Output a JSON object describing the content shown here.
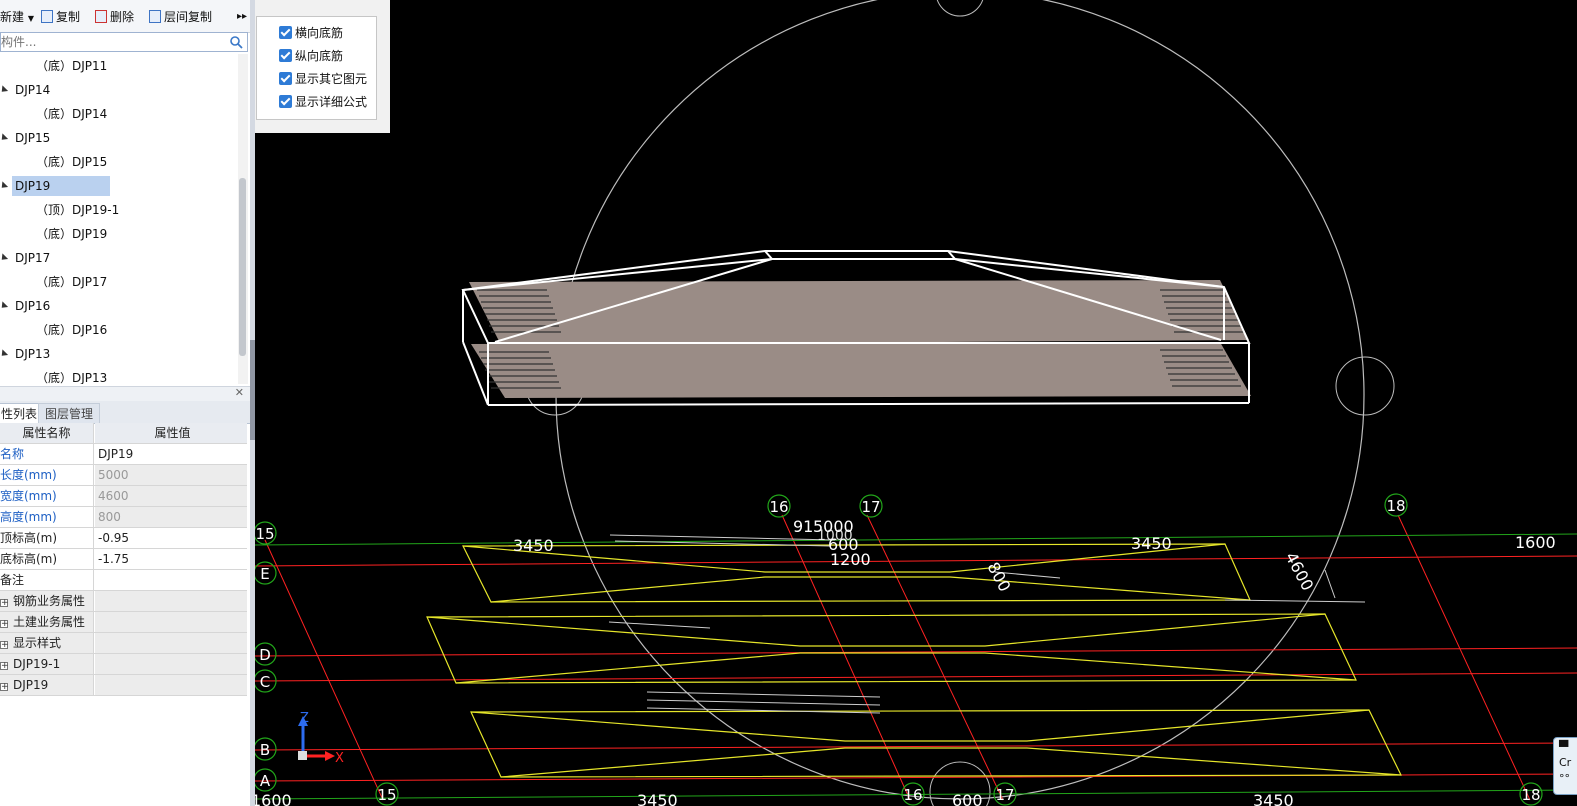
{
  "toolbar": {
    "new_label": "新建",
    "copy_label": "复制",
    "delete_label": "删除",
    "floor_copy_label": "层间复制",
    "more_icon": "double-chevron-right-icon"
  },
  "search": {
    "placeholder": "构件..."
  },
  "tree": {
    "items": [
      {
        "label": "（底）DJP11",
        "level": 1
      },
      {
        "label": "DJP14",
        "level": 0
      },
      {
        "label": "（底）DJP14",
        "level": 1
      },
      {
        "label": "DJP15",
        "level": 0
      },
      {
        "label": "（底）DJP15",
        "level": 1
      },
      {
        "label": "DJP19",
        "level": 0,
        "selected": true
      },
      {
        "label": "（顶）DJP19-1",
        "level": 1
      },
      {
        "label": "（底）DJP19",
        "level": 1
      },
      {
        "label": "DJP17",
        "level": 0
      },
      {
        "label": "（底）DJP17",
        "level": 1
      },
      {
        "label": "DJP16",
        "level": 0
      },
      {
        "label": "（底）DJP16",
        "level": 1
      },
      {
        "label": "DJP13",
        "level": 0
      },
      {
        "label": "（底）DJP13",
        "level": 1
      }
    ]
  },
  "panel_tabs": {
    "attr_list": "性列表",
    "layer_mgmt": "图层管理"
  },
  "prop_table": {
    "header_name": "属性名称",
    "header_value": "属性值",
    "rows": [
      {
        "name": "名称",
        "value": "DJP19"
      },
      {
        "name": "长度(mm)",
        "value": "5000"
      },
      {
        "name": "宽度(mm)",
        "value": "4600"
      },
      {
        "name": "高度(mm)",
        "value": "800"
      },
      {
        "name": "顶标高(m)",
        "value": "-0.95"
      },
      {
        "name": "底标高(m)",
        "value": "-1.75"
      },
      {
        "name": "备注",
        "value": ""
      },
      {
        "name": "钢筋业务属性",
        "value": ""
      },
      {
        "name": "土建业务属性",
        "value": ""
      },
      {
        "name": "显示样式",
        "value": ""
      },
      {
        "name": "DJP19-1",
        "value": ""
      },
      {
        "name": "DJP19",
        "value": ""
      }
    ]
  },
  "options": {
    "horizontal_bottom_rebar": "横向底筋",
    "vertical_bottom_rebar": "纵向底筋",
    "show_other_elements": "显示其它图元",
    "show_detail_formula": "显示详细公式"
  },
  "canvas": {
    "axis_numbers": {
      "a16": "16",
      "a17": "17",
      "a18": "18",
      "a15": "15",
      "b15": "15",
      "b16": "16",
      "b17": "17",
      "b18": "18"
    },
    "axis_letters": {
      "E": "E",
      "D": "D",
      "C": "C",
      "B": "B",
      "A": "A"
    },
    "dims": {
      "d3450_left": "3450",
      "d3450_right": "3450",
      "d1600": "1600",
      "d600": "600",
      "d1200": "1200",
      "d800": "800",
      "d4600": "4600",
      "d_overlap": "91",
      "d5000": "5000",
      "d1000": "1000",
      "b3450_left": "3450",
      "b600": "600",
      "b3450_right": "3450",
      "b1600": "1600"
    },
    "axes": {
      "z": "Z",
      "x": "X"
    },
    "colors": {
      "slab": "#9a8c86",
      "wire": "#ffffff",
      "red_axis": "#ff2222",
      "green_axis": "#22a51a",
      "yellow": "#ffff33",
      "circle": "#bbbbbb"
    }
  },
  "corner": {
    "line1": "Cr",
    "line2": "°°"
  }
}
